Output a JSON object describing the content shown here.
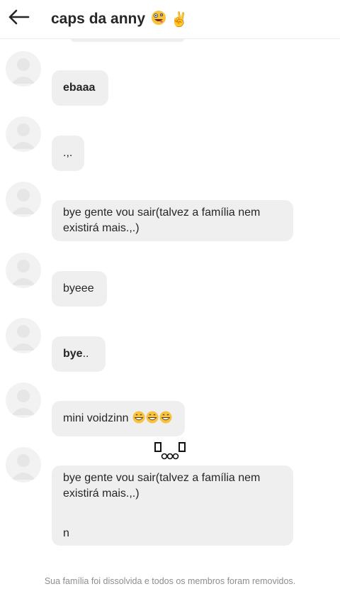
{
  "header": {
    "title": "caps da anny",
    "title_emojis": [
      "zany-face-emoji",
      "victory-hand-emoji"
    ]
  },
  "messages": [
    {
      "text": "ebaaa",
      "bold": true
    },
    {
      "text": ".,."
    },
    {
      "lines": [
        "bye gente vou sair(talvez a família nem",
        "existirá mais.,.)"
      ]
    },
    {
      "text": "byeee"
    },
    {
      "text": "bye",
      "suffix": ".."
    },
    {
      "text": "mini voidzinn",
      "emojis": [
        "grinning-face-emoji",
        "grinning-face-emoji",
        "grinning-face-emoji"
      ]
    },
    {
      "lines": [
        "bye gente vou sair(talvez a família nem",
        "existirá mais.,.)"
      ],
      "extra": "n"
    }
  ],
  "footer": {
    "notice": "Sua família foi dissolvida e todos os membros foram removidos."
  },
  "colors": {
    "bubble_bg": "#efefef",
    "avatar_bg": "#f2f2f2",
    "footer_text": "#8e8e8e"
  }
}
